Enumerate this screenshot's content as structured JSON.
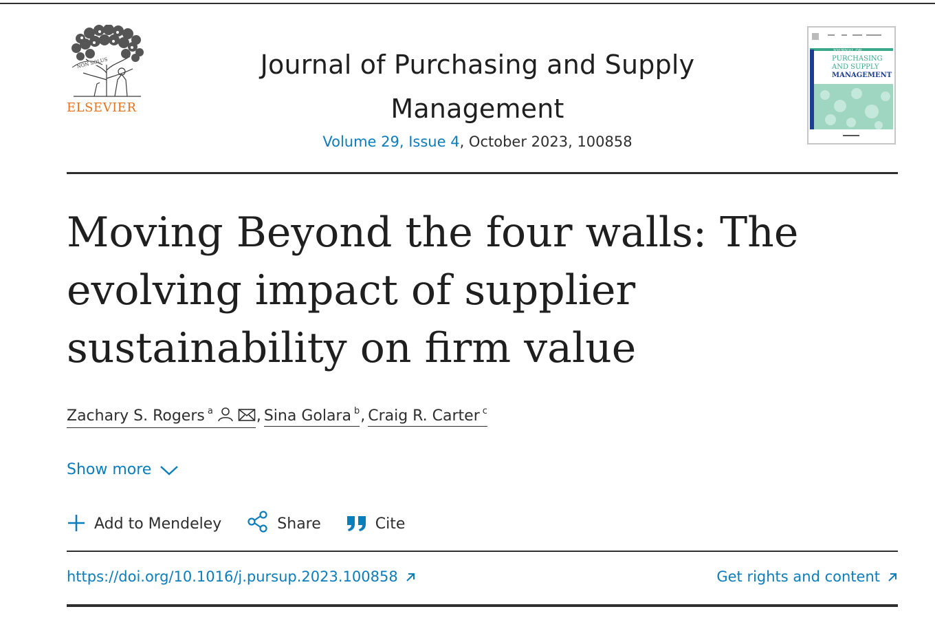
{
  "publisher": {
    "name": "ELSEVIER",
    "logo_motto": "NON SOLUS"
  },
  "journal": {
    "title_line1": "Journal of Purchasing and Supply",
    "title_line2": "Management",
    "issue_link": "Volume 29, Issue 4",
    "issue_rest": ", October 2023, 100858"
  },
  "cover": {
    "title_line1": "JOURNAL OF",
    "title_line2": "PURCHASING",
    "title_line3": "AND SUPPLY",
    "title_line4": "MANAGEMENT",
    "accent_color": "#3aa88a",
    "band_color": "#1c3f8f"
  },
  "article": {
    "title_line1": "Moving Beyond the four walls: The",
    "title_line2": "evolving impact of supplier",
    "title_line3": "sustainability on firm value"
  },
  "authors": [
    {
      "name": "Zachary S. Rogers",
      "affiliation": "a",
      "icons": [
        "person-icon",
        "envelope-icon"
      ]
    },
    {
      "name": "Sina Golara",
      "affiliation": "b"
    },
    {
      "name": "Craig R. Carter",
      "affiliation": "c"
    }
  ],
  "author_separator": ",",
  "show_more": {
    "label": "Show more",
    "icon": "chevron-down-icon"
  },
  "actions": [
    {
      "label": "Add to Mendeley",
      "icon": "plus-icon"
    },
    {
      "label": "Share",
      "icon": "share-icon"
    },
    {
      "label": "Cite",
      "icon": "quote-icon"
    }
  ],
  "links": {
    "doi": "https://doi.org/10.1016/j.pursup.2023.100858",
    "rights": "Get rights and content"
  },
  "colors": {
    "link": "#0c7dbb",
    "publisher_orange": "#e9711c",
    "text": "#1f1f1f"
  }
}
